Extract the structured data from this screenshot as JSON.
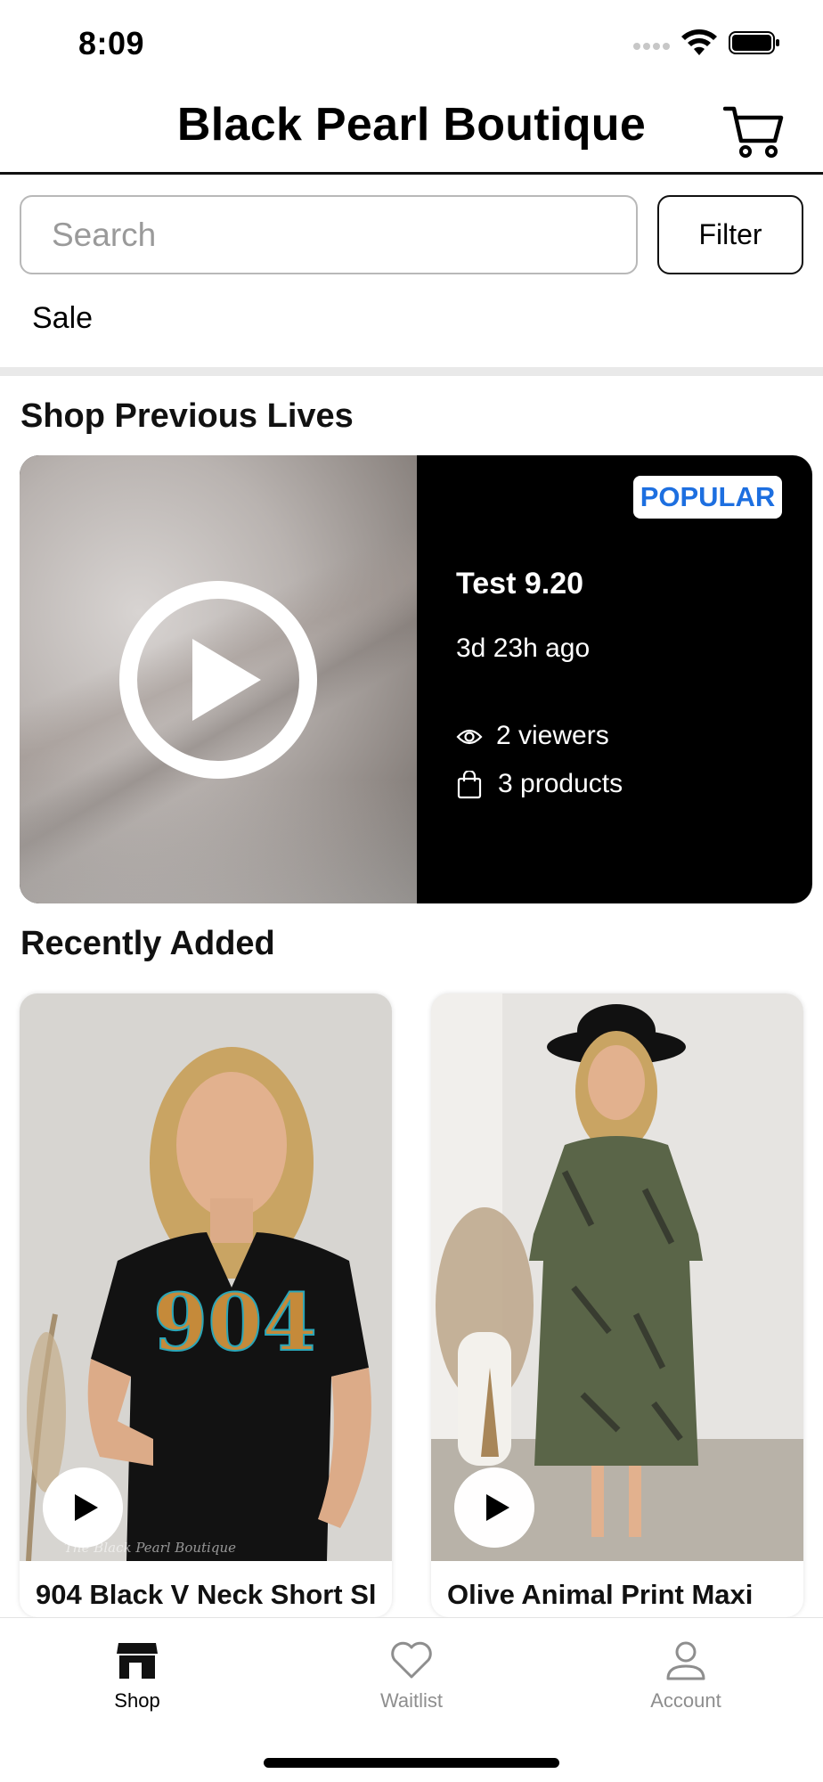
{
  "status_bar": {
    "time": "8:09"
  },
  "header": {
    "title": "Black Pearl Boutique",
    "cart_icon": "cart-icon"
  },
  "search": {
    "placeholder": "Search",
    "value": "",
    "filter_label": "Filter"
  },
  "category_tabs": [
    {
      "label": "Sale"
    }
  ],
  "previous_lives": {
    "section_title": "Shop Previous Lives",
    "card": {
      "badge": "POPULAR",
      "title": "Test 9.20",
      "time_ago": "3d 23h ago",
      "viewers": "2 viewers",
      "products": "3 products"
    }
  },
  "recently_added": {
    "section_title": "Recently Added",
    "products": [
      {
        "name": "904 Black V Neck Short Sl",
        "watermark": "The Black Pearl Boutique",
        "graphic_text": "904"
      },
      {
        "name": "Olive Animal Print Maxi"
      }
    ]
  },
  "tab_bar": {
    "items": [
      {
        "label": "Shop",
        "icon": "store-icon",
        "active": true
      },
      {
        "label": "Waitlist",
        "icon": "heart-icon",
        "active": false
      },
      {
        "label": "Account",
        "icon": "person-icon",
        "active": false
      }
    ]
  },
  "colors": {
    "badge_text": "#1d6fe0",
    "inactive_tab": "#8e8e8e",
    "divider": "#e9e9e9"
  }
}
